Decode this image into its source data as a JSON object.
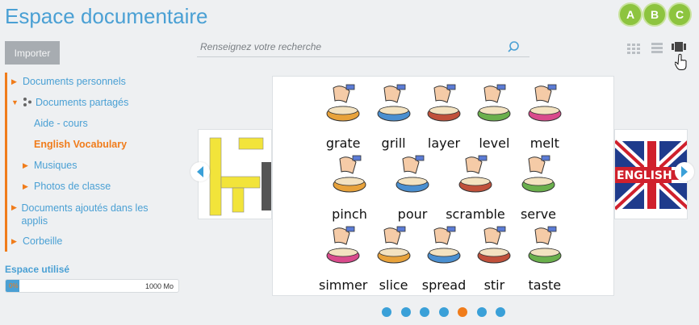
{
  "header": {
    "title": "Espace documentaire"
  },
  "toolbar": {
    "import_label": "Importer"
  },
  "search": {
    "placeholder": "Renseignez votre recherche"
  },
  "view_modes": [
    {
      "badge": "A",
      "icon": "grid-small-icon"
    },
    {
      "badge": "B",
      "icon": "list-icon"
    },
    {
      "badge": "C",
      "icon": "carousel-icon",
      "active": true
    }
  ],
  "sidebar": {
    "items": [
      {
        "label": "Documents personnels",
        "expanded": false
      },
      {
        "label": "Documents partagés",
        "expanded": true
      },
      {
        "label": "Aide - cours"
      },
      {
        "label": "English Vocabulary",
        "active": true
      },
      {
        "label": "Musiques",
        "expanded": false
      },
      {
        "label": "Photos de classe",
        "expanded": false
      },
      {
        "label": "Documents ajoutés dans les applis",
        "expanded": false
      },
      {
        "label": "Corbeille",
        "expanded": false
      }
    ]
  },
  "storage": {
    "label": "Espace utilisé",
    "used_text": "0%",
    "used_fraction": 0.08,
    "total": "1000 Mo"
  },
  "carousel": {
    "prev_icon": "chevron-left-icon",
    "next_icon": "chevron-right-icon",
    "right_card_text": "ENGLISH",
    "current_slide": 5,
    "slide_count": 7,
    "vocab_words": [
      "grate",
      "grill",
      "layer",
      "level",
      "melt",
      "pinch",
      "pour",
      "scramble",
      "serve",
      "simmer",
      "slice",
      "spread",
      "stir",
      "taste"
    ]
  },
  "colors": {
    "accent_blue": "#4aa0d4",
    "accent_orange": "#f07c1b",
    "badge_green": "#8dc43f"
  }
}
